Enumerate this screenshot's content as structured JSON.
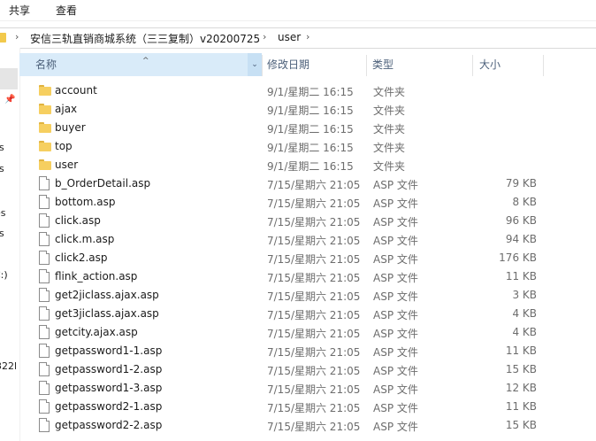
{
  "ribbon": {
    "tabs": [
      "共享",
      "查看"
    ]
  },
  "address": {
    "path_segment": "安信三轨直销商城系统（三三复制）v20200725",
    "current": "user"
  },
  "navpane": {
    "fragments": [
      "s",
      "s",
      "es",
      "s",
      "C:)",
      "322l"
    ]
  },
  "columns": {
    "name": "名称",
    "date": "修改日期",
    "type": "类型",
    "size": "大小"
  },
  "files": [
    {
      "name": "account",
      "kind": "folder",
      "date": "9/1/星期二 16:15",
      "type": "文件夹",
      "size": ""
    },
    {
      "name": "ajax",
      "kind": "folder",
      "date": "9/1/星期二 16:15",
      "type": "文件夹",
      "size": ""
    },
    {
      "name": "buyer",
      "kind": "folder",
      "date": "9/1/星期二 16:15",
      "type": "文件夹",
      "size": ""
    },
    {
      "name": "top",
      "kind": "folder",
      "date": "9/1/星期二 16:15",
      "type": "文件夹",
      "size": ""
    },
    {
      "name": "user",
      "kind": "folder",
      "date": "9/1/星期二 16:15",
      "type": "文件夹",
      "size": ""
    },
    {
      "name": "b_OrderDetail.asp",
      "kind": "file",
      "date": "7/15/星期六 21:05",
      "type": "ASP 文件",
      "size": "79 KB"
    },
    {
      "name": "bottom.asp",
      "kind": "file",
      "date": "7/15/星期六 21:05",
      "type": "ASP 文件",
      "size": "8 KB"
    },
    {
      "name": "click.asp",
      "kind": "file",
      "date": "7/15/星期六 21:05",
      "type": "ASP 文件",
      "size": "96 KB"
    },
    {
      "name": "click.m.asp",
      "kind": "file",
      "date": "7/15/星期六 21:05",
      "type": "ASP 文件",
      "size": "94 KB"
    },
    {
      "name": "click2.asp",
      "kind": "file",
      "date": "7/15/星期六 21:05",
      "type": "ASP 文件",
      "size": "176 KB"
    },
    {
      "name": "flink_action.asp",
      "kind": "file",
      "date": "7/15/星期六 21:05",
      "type": "ASP 文件",
      "size": "11 KB"
    },
    {
      "name": "get2jiclass.ajax.asp",
      "kind": "file",
      "date": "7/15/星期六 21:05",
      "type": "ASP 文件",
      "size": "3 KB"
    },
    {
      "name": "get3jiclass.ajax.asp",
      "kind": "file",
      "date": "7/15/星期六 21:05",
      "type": "ASP 文件",
      "size": "4 KB"
    },
    {
      "name": "getcity.ajax.asp",
      "kind": "file",
      "date": "7/15/星期六 21:05",
      "type": "ASP 文件",
      "size": "4 KB"
    },
    {
      "name": "getpassword1-1.asp",
      "kind": "file",
      "date": "7/15/星期六 21:05",
      "type": "ASP 文件",
      "size": "11 KB"
    },
    {
      "name": "getpassword1-2.asp",
      "kind": "file",
      "date": "7/15/星期六 21:05",
      "type": "ASP 文件",
      "size": "15 KB"
    },
    {
      "name": "getpassword1-3.asp",
      "kind": "file",
      "date": "7/15/星期六 21:05",
      "type": "ASP 文件",
      "size": "12 KB"
    },
    {
      "name": "getpassword2-1.asp",
      "kind": "file",
      "date": "7/15/星期六 21:05",
      "type": "ASP 文件",
      "size": "11 KB"
    },
    {
      "name": "getpassword2-2.asp",
      "kind": "file",
      "date": "7/15/星期六 21:05",
      "type": "ASP 文件",
      "size": "15 KB"
    }
  ]
}
